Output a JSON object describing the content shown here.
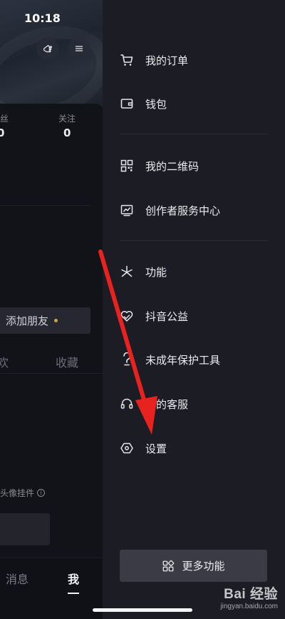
{
  "status_bar": {
    "time": "10:18"
  },
  "background": {
    "stats": {
      "fans_label": "丝",
      "fans_value": "0",
      "following_label": "关注",
      "following_value": "0"
    },
    "add_friend_label": "添加朋友",
    "tabs": {
      "likes": "欢",
      "collect": "收藏"
    },
    "pendant_label": "头像挂件",
    "bottom_nav": {
      "messages": "消息",
      "me": "我"
    }
  },
  "drawer": {
    "group1": [
      {
        "icon": "cart-icon",
        "label": "我的订单"
      },
      {
        "icon": "wallet-icon",
        "label": "钱包"
      }
    ],
    "group2": [
      {
        "icon": "qrcode-icon",
        "label": "我的二维码"
      },
      {
        "icon": "chart-icon",
        "label": "创作者服务中心"
      }
    ],
    "group3": [
      {
        "icon": "sparkle-icon",
        "label": "功能"
      },
      {
        "icon": "heart-hand-icon",
        "label": "抖音公益"
      },
      {
        "icon": "child-protect-icon",
        "label": "未成年保护工具"
      },
      {
        "icon": "headset-icon",
        "label": "我的客服"
      },
      {
        "icon": "settings-hexagon-icon",
        "label": "设置"
      }
    ],
    "more_button_label": "更多功能"
  },
  "watermark": {
    "main": "Bai 经验",
    "sub": "jingyan.baidu.com"
  },
  "colors": {
    "drawer_bg": "#1c1c25",
    "page_bg": "#0e0f16",
    "arrow": "#e8231f",
    "accent_dot": "#c9a544"
  }
}
